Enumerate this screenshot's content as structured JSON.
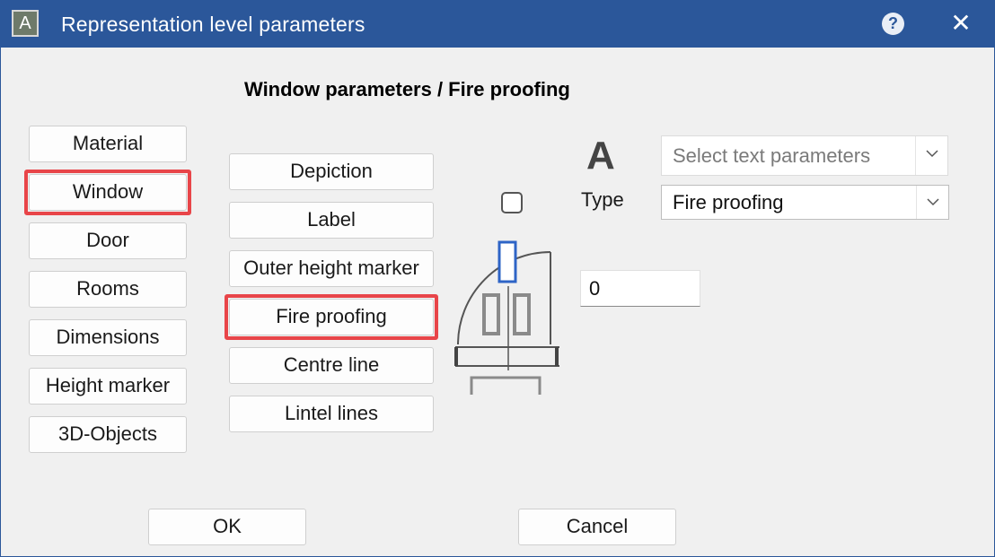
{
  "window": {
    "title": "Representation level parameters",
    "app_icon_glyph": "A",
    "help_glyph": "?",
    "close_glyph": "✕",
    "title_bar_color": "#2b579a",
    "highlight_color": "#e84549"
  },
  "heading": "Window parameters / Fire proofing",
  "categories": {
    "material": "Material",
    "window": "Window",
    "door": "Door",
    "rooms": "Rooms",
    "dimensions": "Dimensions",
    "height_marker": "Height marker",
    "objects_3d": "3D-Objects",
    "selected": "Window"
  },
  "sub_items": {
    "depiction": "Depiction",
    "label": "Label",
    "outer_height_marker": "Outer height marker",
    "fire_proofing": "Fire proofing",
    "centre_line": "Centre line",
    "lintel_lines": "Lintel lines",
    "selected": "Fire proofing"
  },
  "text_params": {
    "font_icon_glyph": "A",
    "select_placeholder": "Select text parameters",
    "type_label": "Type",
    "type_value": "Fire proofing",
    "value_field": "0",
    "checkbox_checked": false
  },
  "footer": {
    "ok": "OK",
    "cancel": "Cancel"
  }
}
